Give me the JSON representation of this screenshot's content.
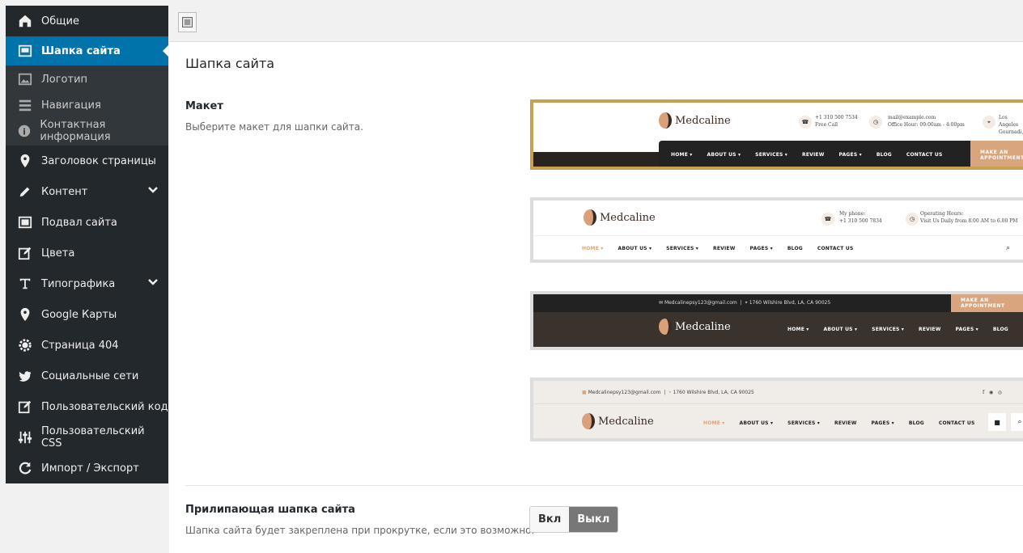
{
  "sidebar": {
    "items": [
      {
        "label": "Общие",
        "icon": "home-icon"
      },
      {
        "label": "Шапка сайта",
        "icon": "header-icon",
        "active": true
      },
      {
        "label": "Логотип",
        "icon": "image-icon",
        "sub": true
      },
      {
        "label": "Навигация",
        "icon": "menu-icon",
        "sub": true
      },
      {
        "label": "Контактная информация",
        "icon": "info-icon",
        "sub": true
      },
      {
        "label": "Заголовок страницы",
        "icon": "pin-icon"
      },
      {
        "label": "Контент",
        "icon": "pencil-icon",
        "chevron": true
      },
      {
        "label": "Подвал сайта",
        "icon": "footer-icon"
      },
      {
        "label": "Цвета",
        "icon": "edit-icon"
      },
      {
        "label": "Типографика",
        "icon": "text-icon",
        "chevron": true
      },
      {
        "label": "Google Карты",
        "icon": "pin-icon"
      },
      {
        "label": "Страница 404",
        "icon": "gear-icon"
      },
      {
        "label": "Социальные сети",
        "icon": "twitter-icon"
      },
      {
        "label": "Пользовательский код",
        "icon": "edit-icon"
      },
      {
        "label": "Пользовательский CSS",
        "icon": "sliders-icon"
      },
      {
        "label": "Импорт / Экспорт",
        "icon": "refresh-icon"
      }
    ]
  },
  "main": {
    "title": "Шапка сайта",
    "layout": {
      "label": "Макет",
      "description": "Выберите макет для шапки сайта."
    },
    "sticky": {
      "label": "Прилипающая шапка сайта",
      "description": "Шапка сайта будет закреплена при прокрутке, если это возможно.",
      "on": "Вкл",
      "off": "Выкл",
      "value": "off"
    }
  },
  "previews": {
    "brand": "Medcaline",
    "nav": [
      "HOME ▾",
      "ABOUT US ▾",
      "SERVICES ▾",
      "REVIEW",
      "PAGES ▾",
      "BLOG",
      "CONTACT US"
    ],
    "p1": {
      "phone": "+1 310 500 7534",
      "phone_sub": "Free Call",
      "mail": "mail@example.com",
      "hours": "Office Hour: 09:00am - 4:00pm",
      "loc": "Los Angeles",
      "loc_sub": "Gournadi,",
      "cta": "MAKE AN APPOINTMENT"
    },
    "p2": {
      "phone_label": "My phone:",
      "phone": "+1 310 500 7834",
      "hours_label": "Operating Hours:",
      "hours": "Visit Us Daily from 8.00 AM to 6.00 PM"
    },
    "email": "Medcalinepsy123@gmail.com",
    "address": "1760 Wilshire Blvd, LA, CA 90025",
    "cta": "MAKE AN APPOINTMENT"
  },
  "colors": {
    "sidebar": "#23282d",
    "active": "#0073aa",
    "selected_border": "#c9a050",
    "accent": "#d9a57f"
  }
}
